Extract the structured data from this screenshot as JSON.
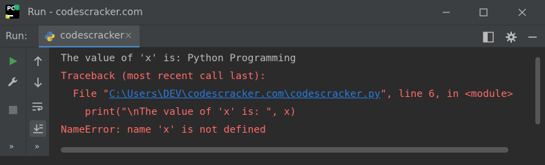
{
  "window": {
    "title": "Run - codescracker.com"
  },
  "tool_window": {
    "label": "Run:",
    "tab": {
      "label": "codescracker",
      "close": "×"
    }
  },
  "toolbar": {
    "more_left": "»",
    "more_right": "»"
  },
  "console": {
    "line1": "The value of 'x' is: Python Programming",
    "line2": "Traceback (most recent call last):",
    "line3_prefix": "  File \"",
    "line3_link": "C:\\Users\\DEV\\codescracker.com\\codescracker.py",
    "line3_suffix": "\", line 6, in <module>",
    "line4": "    print(\"\\nThe value of 'x' is: \", x)",
    "line5": "NameError: name 'x' is not defined"
  },
  "colors": {
    "background": "#2b2b2b",
    "chrome": "#3c3f41",
    "error_text": "#ff6b68",
    "normal_text": "#bbbbbb",
    "link": "#287bde",
    "run_green": "#499c54"
  }
}
